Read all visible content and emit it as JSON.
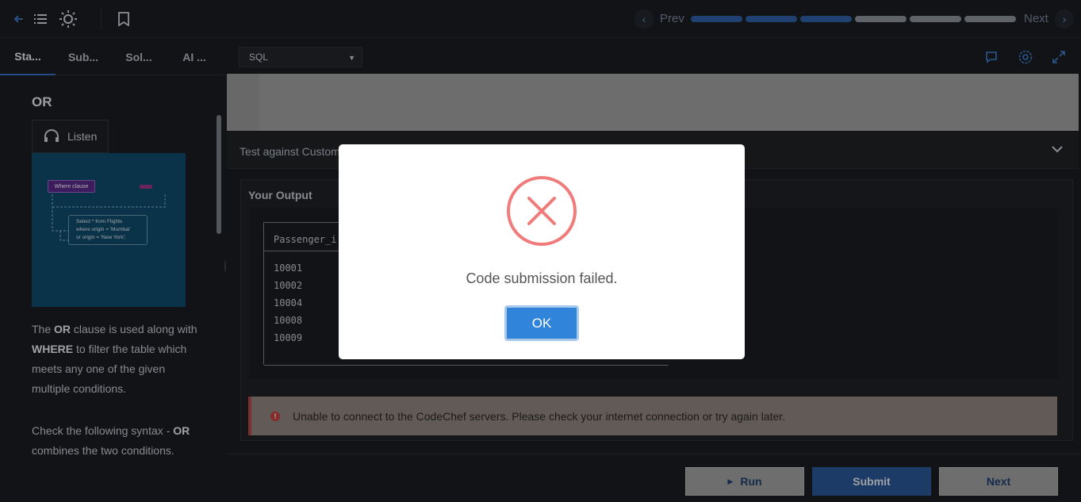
{
  "topbar": {
    "prev_label": "Prev",
    "next_label": "Next",
    "progress": {
      "done": 3,
      "total": 6
    }
  },
  "left": {
    "tabs": [
      {
        "label": "Sta..."
      },
      {
        "label": "Sub..."
      },
      {
        "label": "Sol..."
      },
      {
        "label": "AI ..."
      }
    ],
    "lesson_title": "OR",
    "listen_label": "Listen",
    "diagram": {
      "box_label": "Where clause",
      "code_line1": "Select * from Flights",
      "code_line2": "where origin = 'Mumbai'",
      "code_line3": "or origin = 'New York';"
    },
    "para1": {
      "a": "The ",
      "b": "OR",
      "c": " clause is used along with ",
      "d": "WHERE",
      "e": " to filter the table which meets any one of the given multiple conditions."
    },
    "para2": {
      "a": "Check the following syntax - ",
      "b": "OR",
      "c": " combines the two conditions."
    }
  },
  "right": {
    "language": "SQL",
    "custom_input_label": "Test against Custom Input",
    "output_title": "Your Output",
    "table_header": "Passenger_i",
    "table_rows": [
      "10001",
      "10002",
      "10004",
      "10008",
      "10009"
    ],
    "error_message": "Unable to connect to the CodeChef servers. Please check your internet connection or try again later.",
    "buttons": {
      "run": "Run",
      "submit": "Submit",
      "next": "Next"
    }
  },
  "modal": {
    "message": "Code submission failed.",
    "ok_label": "OK"
  },
  "colors": {
    "accent": "#2a5797",
    "error_icon": "#f07b7b",
    "ok_button": "#3084da"
  }
}
